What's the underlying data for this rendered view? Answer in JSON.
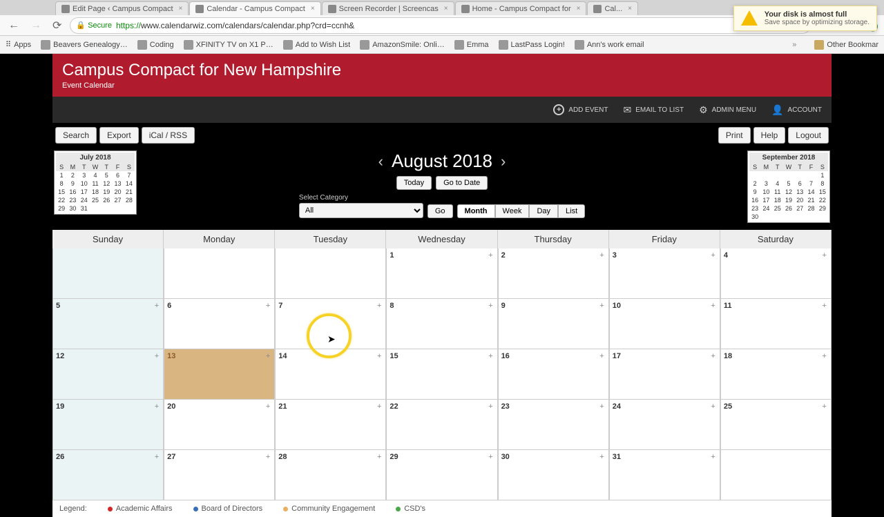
{
  "browser": {
    "tabs": [
      {
        "title": "Edit Page ‹ Campus Compact",
        "active": false
      },
      {
        "title": "Calendar - Campus Compact",
        "active": true
      },
      {
        "title": "Screen Recorder | Screencas",
        "active": false
      },
      {
        "title": "Home - Campus Compact for",
        "active": false
      },
      {
        "title": "Cal...",
        "active": false
      }
    ],
    "secure_label": "Secure",
    "url_proto": "https://",
    "url_rest": "www.calendarwiz.com/calendars/calendar.php?crd=ccnh&",
    "bookmarks": [
      "Apps",
      "Beavers Genealogy…",
      "Coding",
      "XFINITY TV on X1 P…",
      "Add to Wish List",
      "AmazonSmile: Onli…",
      "Emma",
      "LastPass Login!",
      "Ann's work email"
    ],
    "other_bookmarks": "Other Bookmar"
  },
  "notification": {
    "title": "Your disk is almost full",
    "sub": "Save space by optimizing storage."
  },
  "header": {
    "title": "Campus Compact for New Hampshire",
    "sub": "Event Calendar"
  },
  "toolbar": {
    "add": "ADD EVENT",
    "email": "EMAIL TO LIST",
    "admin": "ADMIN MENU",
    "account": "ACCOUNT"
  },
  "controls": {
    "left": [
      "Search",
      "Export",
      "iCal / RSS"
    ],
    "right": [
      "Print",
      "Help",
      "Logout"
    ]
  },
  "month_nav": {
    "title": "August 2018"
  },
  "date_buttons": {
    "today": "Today",
    "goto": "Go to Date"
  },
  "category": {
    "label": "Select Category",
    "selected": "All",
    "go": "Go"
  },
  "views": [
    "Month",
    "Week",
    "Day",
    "List"
  ],
  "active_view": "Month",
  "mini_cals": {
    "prev": {
      "title": "July 2018",
      "dow": [
        "S",
        "M",
        "T",
        "W",
        "T",
        "F",
        "S"
      ],
      "rows": [
        [
          "1",
          "2",
          "3",
          "4",
          "5",
          "6",
          "7"
        ],
        [
          "8",
          "9",
          "10",
          "11",
          "12",
          "13",
          "14"
        ],
        [
          "15",
          "16",
          "17",
          "18",
          "19",
          "20",
          "21"
        ],
        [
          "22",
          "23",
          "24",
          "25",
          "26",
          "27",
          "28"
        ],
        [
          "29",
          "30",
          "31",
          "",
          "",
          "",
          ""
        ]
      ]
    },
    "next": {
      "title": "September 2018",
      "dow": [
        "S",
        "M",
        "T",
        "W",
        "T",
        "F",
        "S"
      ],
      "rows": [
        [
          "",
          "",
          "",
          "",
          "",
          "",
          "1"
        ],
        [
          "2",
          "3",
          "4",
          "5",
          "6",
          "7",
          "8"
        ],
        [
          "9",
          "10",
          "11",
          "12",
          "13",
          "14",
          "15"
        ],
        [
          "16",
          "17",
          "18",
          "19",
          "20",
          "21",
          "22"
        ],
        [
          "23",
          "24",
          "25",
          "26",
          "27",
          "28",
          "29"
        ],
        [
          "30",
          "",
          "",
          "",
          "",
          "",
          ""
        ]
      ]
    }
  },
  "day_headers": [
    "Sunday",
    "Monday",
    "Tuesday",
    "Wednesday",
    "Thursday",
    "Friday",
    "Saturday"
  ],
  "weeks": [
    [
      {
        "n": ""
      },
      {
        "n": ""
      },
      {
        "n": ""
      },
      {
        "n": "1"
      },
      {
        "n": "2"
      },
      {
        "n": "3"
      },
      {
        "n": "4"
      }
    ],
    [
      {
        "n": "5"
      },
      {
        "n": "6"
      },
      {
        "n": "7"
      },
      {
        "n": "8"
      },
      {
        "n": "9"
      },
      {
        "n": "10"
      },
      {
        "n": "11"
      }
    ],
    [
      {
        "n": "12"
      },
      {
        "n": "13",
        "today": true
      },
      {
        "n": "14"
      },
      {
        "n": "15"
      },
      {
        "n": "16"
      },
      {
        "n": "17"
      },
      {
        "n": "18"
      }
    ],
    [
      {
        "n": "19"
      },
      {
        "n": "20"
      },
      {
        "n": "21"
      },
      {
        "n": "22"
      },
      {
        "n": "23"
      },
      {
        "n": "24"
      },
      {
        "n": "25"
      }
    ],
    [
      {
        "n": "26"
      },
      {
        "n": "27"
      },
      {
        "n": "28"
      },
      {
        "n": "29"
      },
      {
        "n": "30"
      },
      {
        "n": "31"
      },
      {
        "n": ""
      }
    ]
  ],
  "legend": {
    "label": "Legend:",
    "items": [
      {
        "c": "#d62728",
        "t": "Academic Affairs"
      },
      {
        "c": "#3b6fb5",
        "t": "Board of Directors"
      },
      {
        "c": "#e8b060",
        "t": "Community Engagement"
      },
      {
        "c": "#4aa84a",
        "t": "CSD's"
      }
    ]
  }
}
